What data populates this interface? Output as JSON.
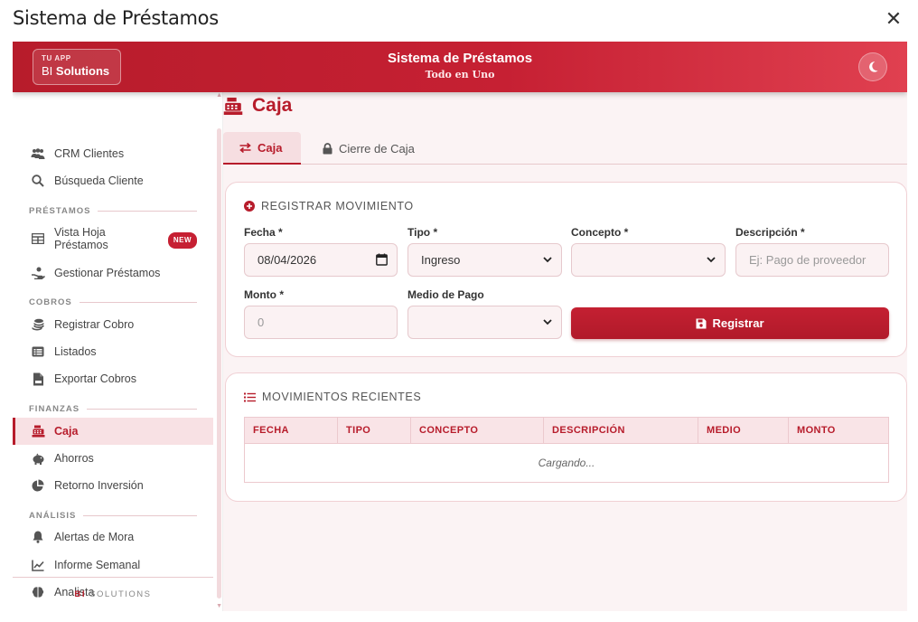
{
  "window": {
    "title": "Sistema de Préstamos",
    "close_glyph": "✕"
  },
  "header": {
    "logo_top": "TU APP",
    "logo_prefix": "BI",
    "logo_bold": "Solutions",
    "title": "Sistema de Préstamos",
    "subtitle": "Todo en Uno",
    "theme_icon": "moon-icon"
  },
  "sidebar": {
    "items": {
      "crm": "CRM Clientes",
      "busqueda": "Búsqueda Cliente",
      "vista_hoja": "Vista Hoja Préstamos",
      "vista_badge": "NEW",
      "gestionar": "Gestionar Préstamos",
      "registrar_cobro": "Registrar Cobro",
      "listados": "Listados",
      "exportar": "Exportar Cobros",
      "caja": "Caja",
      "ahorros": "Ahorros",
      "retorno": "Retorno Inversión",
      "alertas": "Alertas de Mora",
      "informe": "Informe Semanal",
      "analista": "Analista"
    },
    "sections": {
      "prestamos": "PRÉSTAMOS",
      "cobros": "COBROS",
      "finanzas": "FINANZAS",
      "analisis": "ANÁLISIS"
    },
    "footer_bold": "BI",
    "footer_text": "SOLUTIONS"
  },
  "main": {
    "page_title": "Caja",
    "tabs": {
      "caja": "Caja",
      "cierre": "Cierre de Caja"
    },
    "form": {
      "title": "REGISTRAR MOVIMIENTO",
      "fecha_label": "Fecha *",
      "fecha_value": "08/04/2026",
      "tipo_label": "Tipo *",
      "tipo_value": "Ingreso",
      "concepto_label": "Concepto *",
      "concepto_value": "",
      "descripcion_label": "Descripción *",
      "descripcion_placeholder": "Ej: Pago de proveedor",
      "monto_label": "Monto *",
      "monto_placeholder": "0",
      "medio_label": "Medio de Pago",
      "medio_value": "",
      "submit_label": "Registrar"
    },
    "recent": {
      "title": "MOVIMIENTOS RECIENTES",
      "columns": [
        "FECHA",
        "TIPO",
        "CONCEPTO",
        "DESCRIPCIÓN",
        "MEDIO",
        "MONTO"
      ],
      "loading": "Cargando..."
    }
  },
  "colors": {
    "accent": "#b71c2b",
    "accent_light": "#f8e1e4",
    "background": "#fbf3f4"
  }
}
